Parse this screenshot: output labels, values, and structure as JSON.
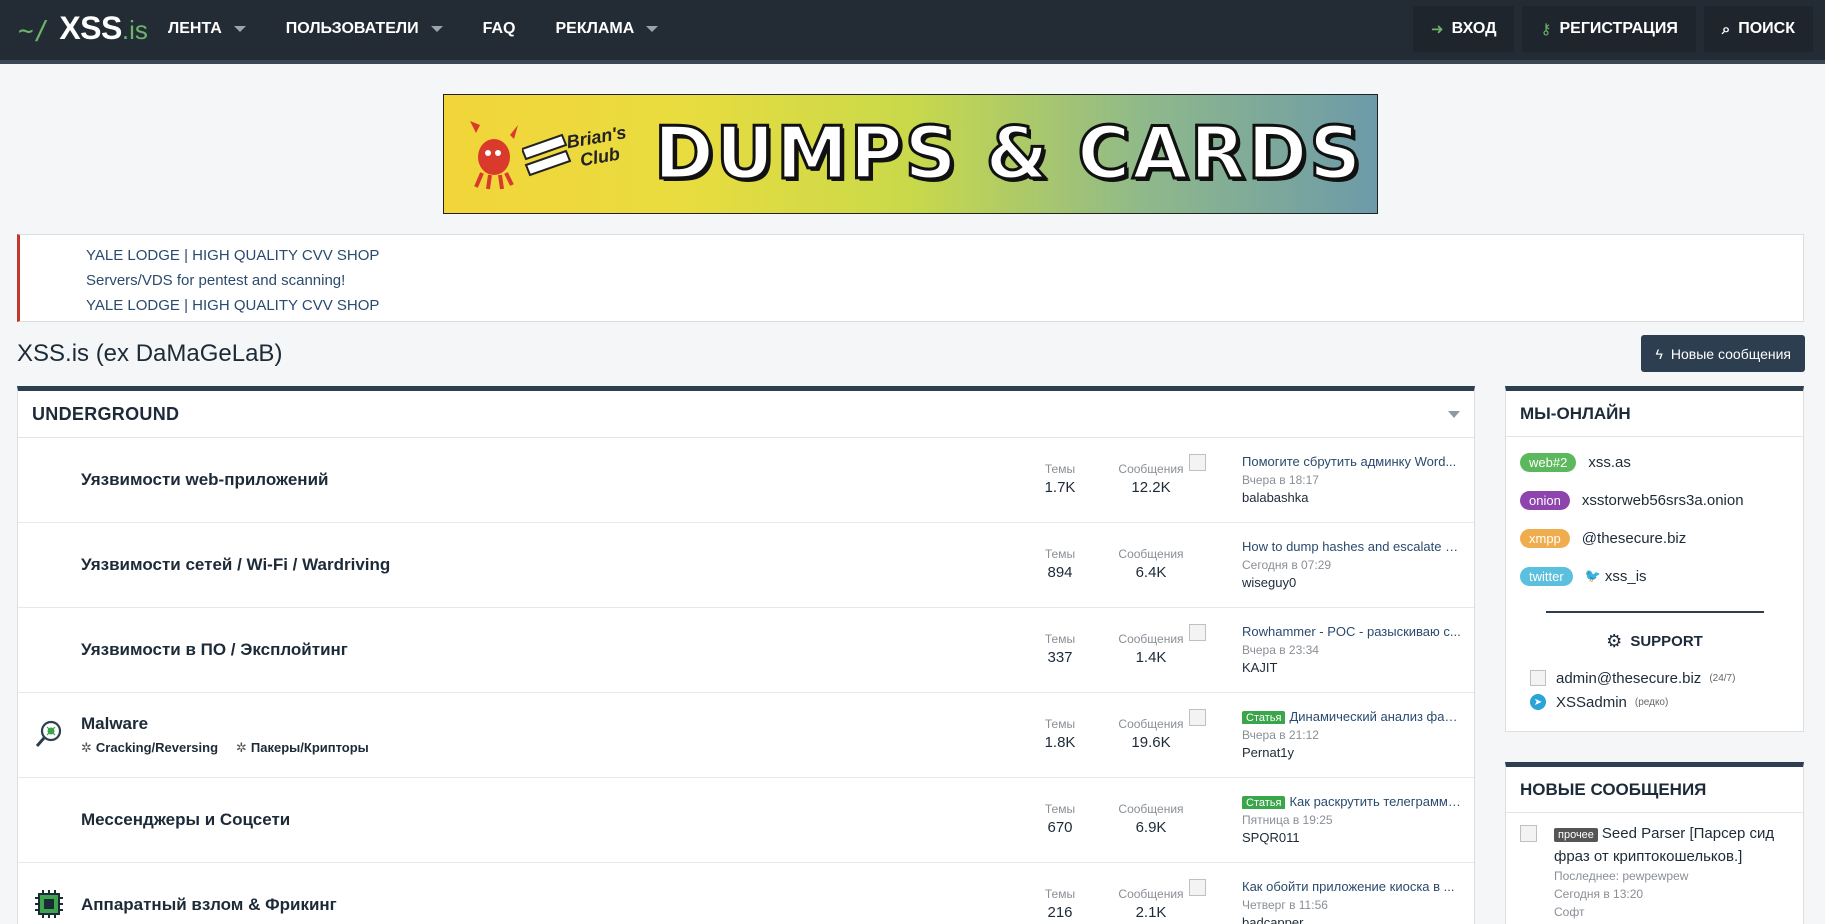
{
  "nav": {
    "logo_tilde": "~/",
    "logo_name": "XSS",
    "logo_tld": ".is",
    "items": [
      {
        "label": "ЛЕНТА",
        "has_caret": true
      },
      {
        "label": "ПОЛЬЗОВАТЕЛИ",
        "has_caret": true
      },
      {
        "label": "FAQ",
        "has_caret": false
      },
      {
        "label": "РЕКЛАМА",
        "has_caret": true
      }
    ],
    "login": "ВХОД",
    "register": "РЕГИСТРАЦИЯ",
    "search": "ПОИСК"
  },
  "banner": {
    "brand_line1": "Brian's",
    "brand_line2": "Club",
    "title": "DUMPS & CARDS"
  },
  "notices": [
    "YALE LODGE | HIGH QUALITY CVV SHOP",
    "Servers/VDS for pentest and scanning!",
    "YALE LODGE | HIGH QUALITY CVV SHOP"
  ],
  "page": {
    "title": "XSS.is (ex DaMaGeLaB)",
    "new_posts_button": "Новые сообщения"
  },
  "forum": {
    "category": "UNDERGROUND",
    "stat_threads": "Темы",
    "stat_messages": "Сообщения",
    "nodes": [
      {
        "title": "Уязвимости web-приложений",
        "threads": "1.7K",
        "messages": "12.2K",
        "last_title": "Помогите сбрутить админку Word...",
        "last_badge": "",
        "last_date": "Вчера в 18:17",
        "last_user": "balabashka",
        "subs": [],
        "icon": ""
      },
      {
        "title": "Уязвимости сетей / Wi-Fi / Wardriving",
        "threads": "894",
        "messages": "6.4K",
        "last_title": "How to dump hashes and escalate p...",
        "last_badge": "",
        "last_date": "Сегодня в 07:29",
        "last_user": "wiseguy0",
        "subs": [],
        "icon": ""
      },
      {
        "title": "Уязвимости в ПО / Эксплойтинг",
        "threads": "337",
        "messages": "1.4K",
        "last_title": "Rowhammer - POC - разыскиваю с...",
        "last_badge": "",
        "last_date": "Вчера в 23:34",
        "last_user": "KAJIT",
        "subs": [],
        "icon": ""
      },
      {
        "title": "Malware",
        "threads": "1.8K",
        "messages": "19.6K",
        "last_title": "Динамический анализ фай...",
        "last_badge": "Статья",
        "last_date": "Вчера в 21:12",
        "last_user": "Pernat1y",
        "subs": [
          "Cracking/Reversing",
          "Пакеры/Крипторы"
        ],
        "icon": "magnifier-bug-icon"
      },
      {
        "title": "Мессенджеры и Соцсети",
        "threads": "670",
        "messages": "6.9K",
        "last_title": "Как раскрутить телеграмм ...",
        "last_badge": "Статья",
        "last_date": "Пятница в 19:25",
        "last_user": "SPQR011",
        "subs": [],
        "icon": ""
      },
      {
        "title": "Аппаратный взлом & Фрикинг",
        "threads": "216",
        "messages": "2.1K",
        "last_title": "Как обойти приложение киоска в ...",
        "last_badge": "",
        "last_date": "Четверг в 11:56",
        "last_user": "badcapper",
        "subs": [],
        "icon": "chip-icon"
      }
    ]
  },
  "online": {
    "title": "МЫ-ОНЛАЙН",
    "entries": [
      {
        "tag": "web#2",
        "color": "#5cb85c",
        "value": "xss.as"
      },
      {
        "tag": "onion",
        "color": "#8e44ad",
        "value": "xsstorweb56srs3a.onion"
      },
      {
        "tag": "xmpp",
        "color": "#f0ad4e",
        "value": "@thesecure.biz"
      },
      {
        "tag": "twitter",
        "color": "#5bc0de",
        "value": "xss_is"
      }
    ],
    "support_title": "SUPPORT",
    "contacts": [
      {
        "value": "admin@thesecure.biz",
        "note": "(24/7)"
      },
      {
        "value": "XSSadmin",
        "note": "(редко)"
      }
    ]
  },
  "new_posts": {
    "title": "НОВЫЕ СООБЩЕНИЯ",
    "items": [
      {
        "prefix": "прочее",
        "title": "Seed Parser [Парсер сид фраз от криптокошельков.]",
        "last": "Последнее: pewpewpew",
        "date": "Сегодня в 13:20",
        "forum": "Софт"
      }
    ]
  }
}
